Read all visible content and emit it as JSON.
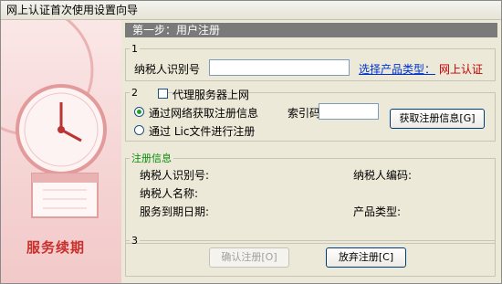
{
  "window": {
    "title": "网上认证首次使用设置向导"
  },
  "sidebar": {
    "renew_text": "服务续期"
  },
  "step": {
    "title": "第一步：用户注册"
  },
  "group1": {
    "legend": "1",
    "taxpayer_id_label": "纳税人识别号",
    "taxpayer_id_value": "",
    "select_product_link": "选择产品类型：",
    "product_value": "网上认证"
  },
  "group2": {
    "legend": "2",
    "proxy_label": "代理服务器上网",
    "proxy_checked": false,
    "radio_network_label": "通过网络获取注册信息",
    "radio_lic_label": "通过 Lic文件进行注册",
    "index_code_label": "索引码",
    "index_code_value": "",
    "fetch_button": "获取注册信息[G]"
  },
  "reg_info": {
    "legend": "注册信息",
    "taxpayer_id_label": "纳税人识别号:",
    "taxpayer_code_label": "纳税人编码:",
    "taxpayer_name_label": "纳税人名称:",
    "service_expiry_label": "服务到期日期:",
    "product_type_label": "产品类型:"
  },
  "group3": {
    "legend": "3",
    "confirm_button": "确认注册[O]",
    "cancel_button": "放弃注册[C]"
  },
  "colors": {
    "step_bar": "#7a7a7a",
    "sidebar_bg": "#f6d6d6",
    "renew_text": "#c9302c",
    "link": "#0033cc",
    "product_value": "#c00000",
    "reg_legend": "#0a8a0a"
  }
}
